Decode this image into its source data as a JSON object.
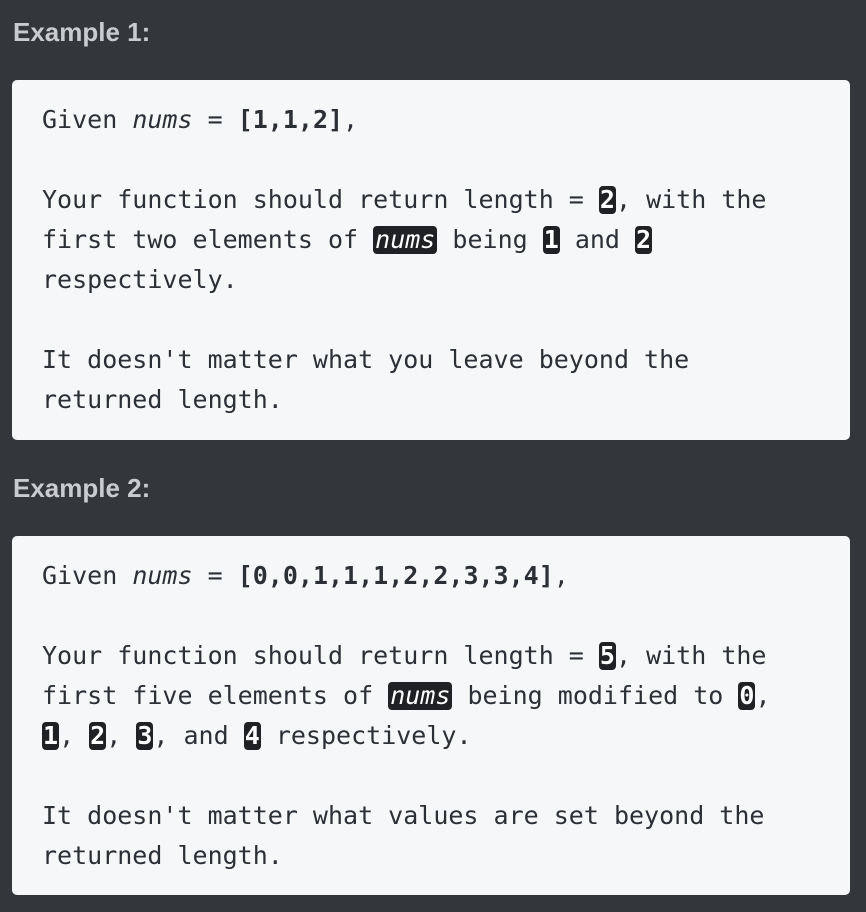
{
  "examples": [
    {
      "heading": "Example 1:",
      "l1": {
        "a": "Given ",
        "b": "nums",
        "c": " = ",
        "d": "[1,1,2]",
        "e": ","
      },
      "l2": {
        "a": "Your function should return length = ",
        "hl": "2",
        "b": ", with the"
      },
      "l3": {
        "a": "first two elements of ",
        "hl1": "nums",
        "b": " being ",
        "hl2": "1",
        "c": " and ",
        "hl3": "2"
      },
      "l4": "respectively.",
      "l5": "It doesn't matter what you leave beyond the",
      "l6": "returned length."
    },
    {
      "heading": "Example 2:",
      "l1": {
        "a": "Given ",
        "b": "nums",
        "c": " = ",
        "d": "[0,0,1,1,1,2,2,3,3,4]",
        "e": ","
      },
      "l2": {
        "a": "Your function should return length = ",
        "hl": "5",
        "b": ", with the"
      },
      "l3": {
        "a": "first five elements of ",
        "hl1": "nums",
        "b": " being modified to ",
        "hl2": "0",
        "c": ","
      },
      "l4": {
        "hl1": "1",
        "a": ", ",
        "hl2": "2",
        "b": ", ",
        "hl3": "3",
        "c": ", and ",
        "hl4": "4",
        "d": " respectively."
      },
      "l5": "It doesn't matter what values are set beyond the",
      "l6": "returned length."
    }
  ]
}
